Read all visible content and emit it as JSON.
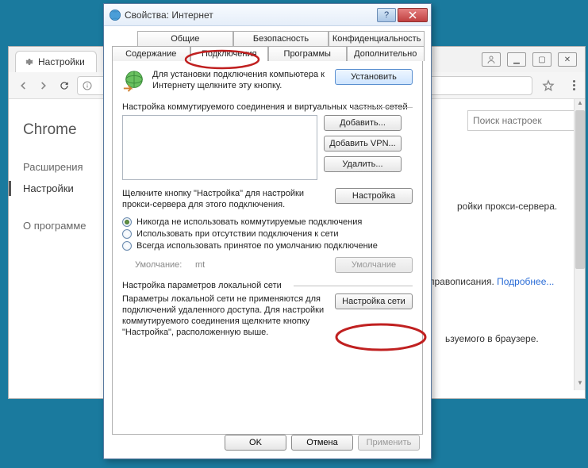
{
  "chrome": {
    "tab_title": "Настройки",
    "app_name": "Chrome",
    "sidebar": {
      "ext": "Расширения",
      "settings": "Настройки",
      "about": "О программе"
    },
    "search_placeholder": "Поиск настроек",
    "body1": "ройки прокси-сервера.",
    "body2_a": "правописания. ",
    "body2_link": "Подробнее...",
    "body3": "ьзуемого в браузере."
  },
  "dialog": {
    "title": "Свойства: Интернет",
    "tabs": {
      "general": "Общие",
      "security": "Безопасность",
      "privacy": "Конфиденциальность",
      "content": "Содержание",
      "connections": "Подключения",
      "programs": "Программы",
      "advanced": "Дополнительно"
    },
    "install_text": "Для установки подключения компьютера к Интернету щелкните эту кнопку.",
    "install_btn": "Установить",
    "dial_label": "Настройка коммутируемого соединения и виртуальных частных сетей",
    "add_btn": "Добавить...",
    "add_vpn_btn": "Добавить VPN...",
    "delete_btn": "Удалить...",
    "proxy_text": "Щелкните кнопку \"Настройка\" для настройки прокси-сервера для этого подключения.",
    "settings_btn": "Настройка",
    "radio1": "Никогда не использовать коммутируемые подключения",
    "radio2": "Использовать при отсутствии подключения к сети",
    "radio3": "Всегда использовать принятое по умолчанию подключение",
    "default_lbl": "Умолчание:",
    "default_val": "mt",
    "default_btn": "Умолчание",
    "lan_label": "Настройка параметров локальной сети",
    "lan_text": "Параметры локальной сети не применяются для подключений удаленного доступа. Для настройки коммутируемого соединения щелкните кнопку \"Настройка\", расположенную выше.",
    "lan_btn": "Настройка сети",
    "ok": "OK",
    "cancel": "Отмена",
    "apply": "Применить"
  }
}
